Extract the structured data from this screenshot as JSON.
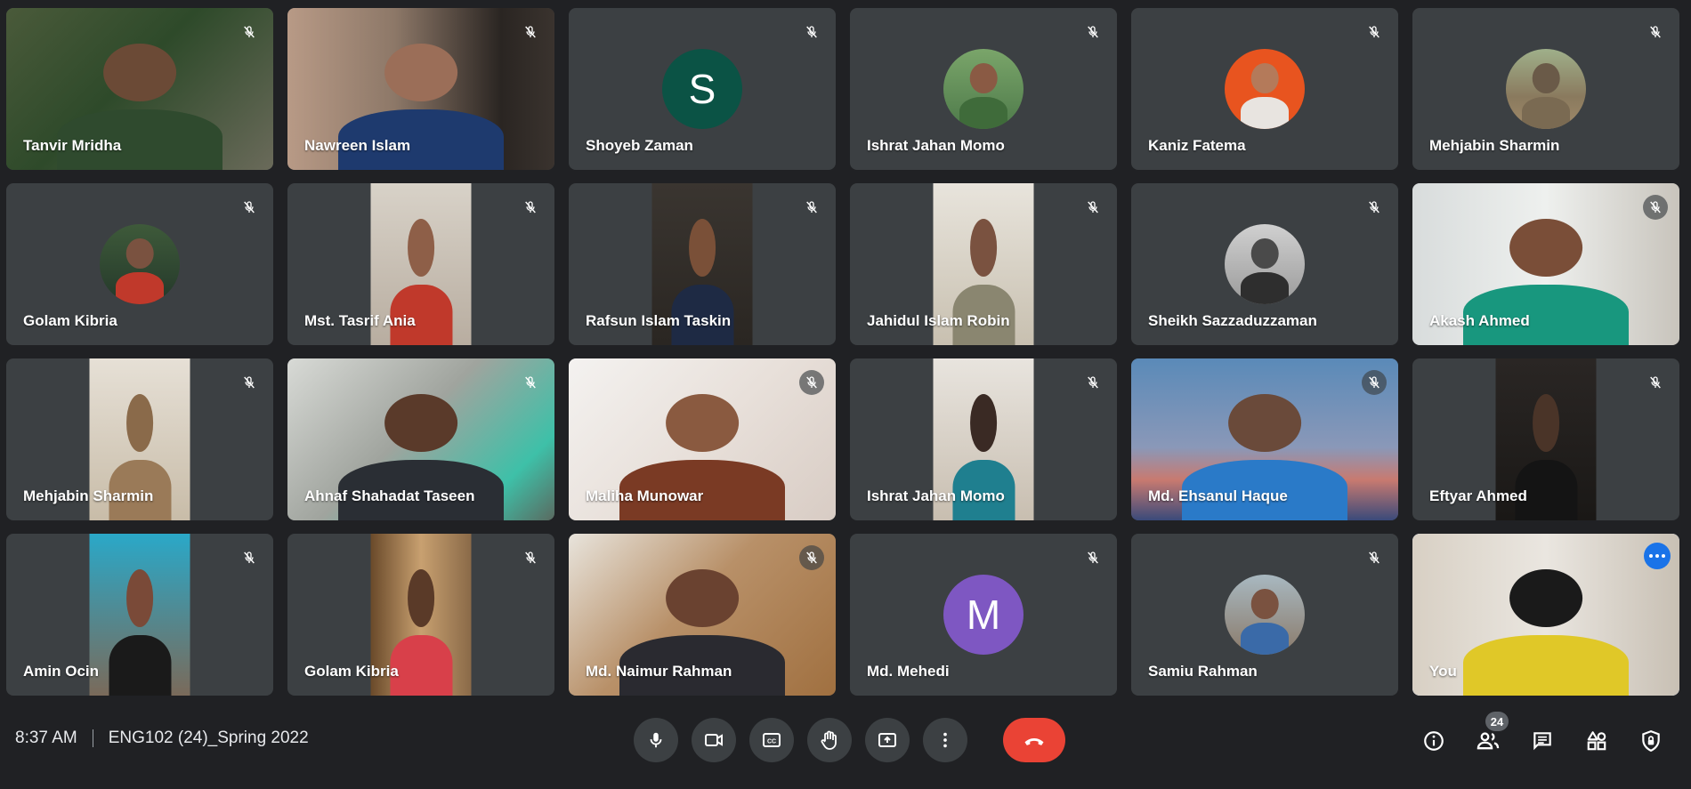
{
  "meeting": {
    "time": "8:37 AM",
    "title": "ENG102 (24)_Spring 2022",
    "participant_count": "24"
  },
  "colors": {
    "background": "#202124",
    "tile": "#3c4043",
    "hangup": "#ea4335",
    "self_outline": "#8ab4f8",
    "options_button": "#1a73e8"
  },
  "participants": [
    {
      "name": "Tanvir Mridha",
      "muted": true
    },
    {
      "name": "Nawreen Islam",
      "muted": true
    },
    {
      "name": "Shoyeb Zaman",
      "muted": true,
      "avatar_letter": "S",
      "avatar_color": "#0b5345"
    },
    {
      "name": "Ishrat Jahan Momo",
      "muted": true
    },
    {
      "name": "Kaniz Fatema",
      "muted": true
    },
    {
      "name": "Mehjabin Sharmin",
      "muted": true
    },
    {
      "name": "Golam Kibria",
      "muted": true
    },
    {
      "name": "Mst. Tasrif Ania",
      "muted": true
    },
    {
      "name": "Rafsun Islam Taskin",
      "muted": true
    },
    {
      "name": "Jahidul Islam Robin",
      "muted": true
    },
    {
      "name": "Sheikh Sazzaduzzaman",
      "muted": true
    },
    {
      "name": "Akash Ahmed",
      "muted": true
    },
    {
      "name": "Mehjabin Sharmin",
      "muted": true
    },
    {
      "name": "Ahnaf Shahadat Taseen",
      "muted": true
    },
    {
      "name": "Maliha Munowar",
      "muted": true
    },
    {
      "name": "Ishrat Jahan Momo",
      "muted": true
    },
    {
      "name": "Md. Ehsanul Haque",
      "muted": true
    },
    {
      "name": "Eftyar Ahmed",
      "muted": true
    },
    {
      "name": "Amin Ocin",
      "muted": true
    },
    {
      "name": "Golam Kibria",
      "muted": true
    },
    {
      "name": "Md. Naimur Rahman",
      "muted": true
    },
    {
      "name": "Md. Mehedi",
      "muted": true,
      "avatar_letter": "M",
      "avatar_color": "#7e57c2"
    },
    {
      "name": "Samiu Rahman",
      "muted": true
    },
    {
      "name": "You",
      "muted": false
    }
  ],
  "controls": [
    {
      "name": "microphone-icon"
    },
    {
      "name": "camera-icon"
    },
    {
      "name": "captions-icon"
    },
    {
      "name": "raise-hand-icon"
    },
    {
      "name": "present-screen-icon"
    },
    {
      "name": "more-options-icon"
    },
    {
      "name": "hang-up-icon"
    }
  ],
  "side_icons": [
    "info-icon",
    "people-icon",
    "chat-icon",
    "activities-icon",
    "host-controls-icon"
  ]
}
